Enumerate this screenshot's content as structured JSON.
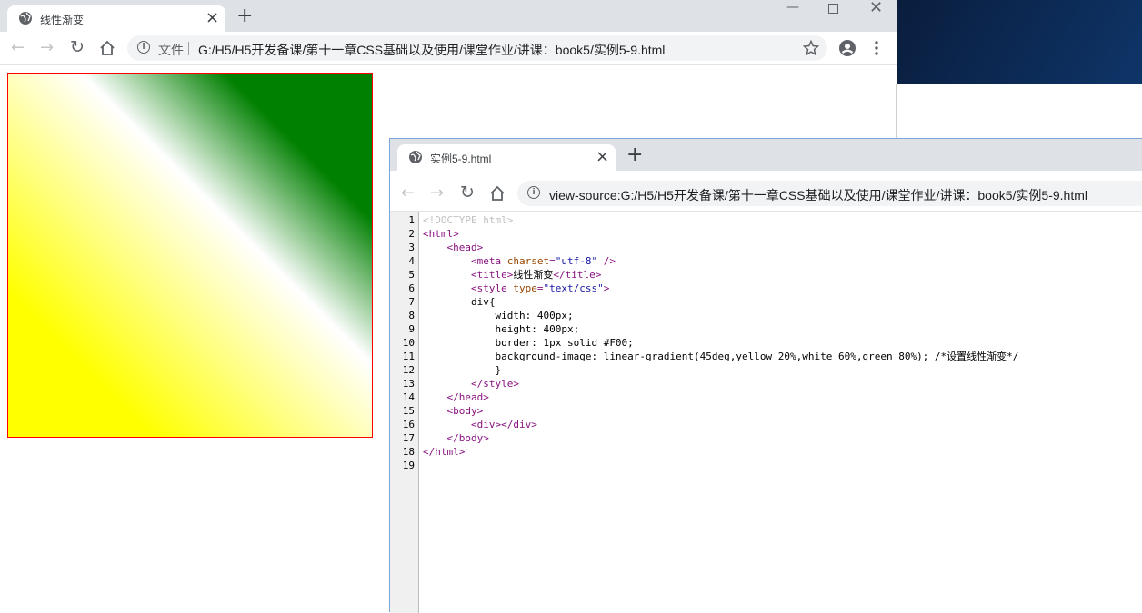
{
  "window1": {
    "tab_title": "线性渐变",
    "new_tab_label": "+",
    "address": {
      "security_label": "文件",
      "url": "G:/H5/H5开发备课/第十一章CSS基础以及使用/课堂作业/讲课：book5/实例5-9.html"
    }
  },
  "window2": {
    "tab_title": "实例5-9.html",
    "new_tab_label": "+",
    "address": {
      "url": "view-source:G:/H5/H5开发备课/第十一章CSS基础以及使用/课堂作业/讲课：book5/实例5-9.html"
    },
    "source_lines": [
      {
        "num": "1",
        "indent": "",
        "parts": [
          {
            "t": "<!DOCTYPE html>",
            "c": "doctype"
          }
        ]
      },
      {
        "num": "2",
        "indent": "",
        "parts": [
          {
            "t": "<html>",
            "c": "tag"
          }
        ]
      },
      {
        "num": "3",
        "indent": "    ",
        "parts": [
          {
            "t": "<head>",
            "c": "tag"
          }
        ]
      },
      {
        "num": "4",
        "indent": "        ",
        "parts": [
          {
            "t": "<meta ",
            "c": "tag"
          },
          {
            "t": "charset",
            "c": "attr"
          },
          {
            "t": "=",
            "c": "tag"
          },
          {
            "t": "\"utf-8\"",
            "c": "val"
          },
          {
            "t": " />",
            "c": "tag"
          }
        ]
      },
      {
        "num": "5",
        "indent": "        ",
        "parts": [
          {
            "t": "<title>",
            "c": "tag"
          },
          {
            "t": "线性渐变",
            "c": "text"
          },
          {
            "t": "</title>",
            "c": "tag"
          }
        ]
      },
      {
        "num": "6",
        "indent": "        ",
        "parts": [
          {
            "t": "<style ",
            "c": "tag"
          },
          {
            "t": "type",
            "c": "attr"
          },
          {
            "t": "=",
            "c": "tag"
          },
          {
            "t": "\"text/css\"",
            "c": "val"
          },
          {
            "t": ">",
            "c": "tag"
          }
        ]
      },
      {
        "num": "7",
        "indent": "        ",
        "parts": [
          {
            "t": "div{",
            "c": "text"
          }
        ]
      },
      {
        "num": "8",
        "indent": "            ",
        "parts": [
          {
            "t": "width: 400px;",
            "c": "text"
          }
        ]
      },
      {
        "num": "9",
        "indent": "            ",
        "parts": [
          {
            "t": "height: 400px;",
            "c": "text"
          }
        ]
      },
      {
        "num": "10",
        "indent": "            ",
        "parts": [
          {
            "t": "border: 1px solid #F00;",
            "c": "text"
          }
        ]
      },
      {
        "num": "11",
        "indent": "            ",
        "parts": [
          {
            "t": "background-image: linear-gradient(45deg,yellow 20%,white 60%,green 80%); /*设置线性渐变*/",
            "c": "text"
          }
        ]
      },
      {
        "num": "12",
        "indent": "            ",
        "parts": [
          {
            "t": "}",
            "c": "text"
          }
        ]
      },
      {
        "num": "13",
        "indent": "        ",
        "parts": [
          {
            "t": "</style>",
            "c": "tag"
          }
        ]
      },
      {
        "num": "14",
        "indent": "    ",
        "parts": [
          {
            "t": "</head>",
            "c": "tag"
          }
        ]
      },
      {
        "num": "15",
        "indent": "    ",
        "parts": [
          {
            "t": "<body>",
            "c": "tag"
          }
        ]
      },
      {
        "num": "16",
        "indent": "        ",
        "parts": [
          {
            "t": "<div>",
            "c": "tag"
          },
          {
            "t": "</div>",
            "c": "tag"
          }
        ]
      },
      {
        "num": "17",
        "indent": "    ",
        "parts": [
          {
            "t": "</body>",
            "c": "tag"
          }
        ]
      },
      {
        "num": "18",
        "indent": "",
        "parts": [
          {
            "t": "</html>",
            "c": "tag"
          }
        ]
      },
      {
        "num": "19",
        "indent": "",
        "parts": []
      }
    ]
  },
  "demo_box": {
    "gradient": "linear-gradient(45deg,yellow 20%,white 60%,green 80%)",
    "border_color": "#ff0000"
  },
  "icons": {
    "globe": "globe-icon",
    "close": "close-icon",
    "back": "back-arrow-icon",
    "forward": "forward-arrow-icon",
    "reload": "reload-icon",
    "home": "home-icon",
    "info": "info-icon",
    "star": "star-icon",
    "account": "account-icon",
    "menu": "menu-icon"
  }
}
